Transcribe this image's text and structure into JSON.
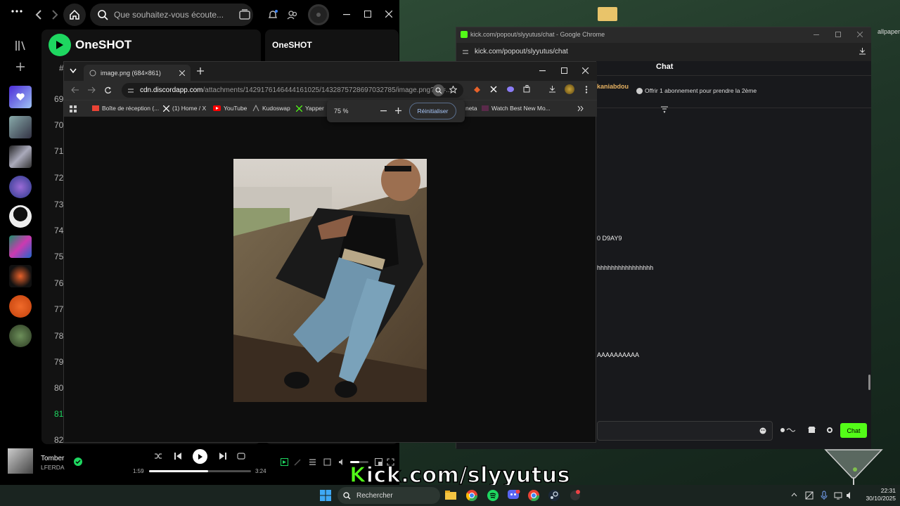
{
  "spotify": {
    "search_placeholder": "Que souhaitez-vous écoute...",
    "now_playing_title": "OneSHOT",
    "right_panel_title": "OneSHOT",
    "lyric_numbers": [
      "69",
      "70",
      "71",
      "72",
      "73",
      "74",
      "75",
      "76",
      "77",
      "78",
      "79",
      "80",
      "81",
      "82"
    ],
    "track": {
      "title": "Tomber",
      "artist": "LFERDA"
    },
    "time_elapsed": "1:59",
    "time_total": "3:24",
    "progress_fraction": 0.58,
    "volume_fraction": 0.5
  },
  "kick": {
    "window_title": "kick.com/popout/slyyutus/chat - Google Chrome",
    "url": "kick.com/popout/slyyutus/chat",
    "header": "Chat",
    "pinned_user": "kaniabdou",
    "pinned_text": "Offrir 1 abonnement pour prendre la 2ème",
    "messages": [
      "0 D9AY9",
      "hhhhhhhhhhhhhhhh",
      "AAAAAAAAAA"
    ],
    "chat_button": "Chat"
  },
  "image_window": {
    "tab_title": "image.png (684×861)",
    "url_domain": "cdn.discordapp.com",
    "url_path": "/attachments/1429176146444161025/1432875728697032785/image.png?ex=...",
    "bookmarks": [
      "Boîte de réception (...",
      "(1) Home / X",
      "YouTube",
      "Kudoswap",
      "Yapper",
      "neta",
      "Watch Best New Mo..."
    ],
    "zoom_level": "75 %",
    "reset_label": "Réinitialiser"
  },
  "taskbar": {
    "search_placeholder": "Rechercher",
    "time": "22:31",
    "date": "30/10/2025"
  },
  "overlay": {
    "k": "K",
    "text": "ick.com/slyyutus"
  },
  "wallpaper_label": "allpaper",
  "colors": {
    "spotify_green": "#1ed760",
    "kick_green": "#53fc18"
  }
}
